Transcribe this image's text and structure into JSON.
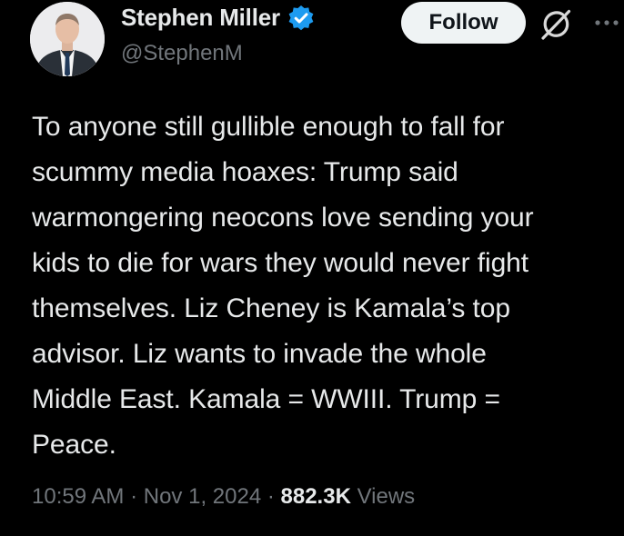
{
  "author": {
    "display_name": "Stephen Miller",
    "handle": "@StephenM",
    "verified": true,
    "verified_color": "#1d9bf0"
  },
  "icons": {
    "verified": "verified-badge-icon",
    "grok": "grok-icon",
    "more": "more-options-icon"
  },
  "actions": {
    "follow_label": "Follow"
  },
  "tweet": {
    "lines": [
      "To anyone still gullible enough to fall for",
      "scummy media hoaxes: Trump said",
      "warmongering neocons love sending your",
      "kids to die for wars they would never fight",
      "themselves. Liz Cheney is Kamala’s top",
      "advisor. Liz wants to invade the whole",
      "Middle East. Kamala = WWIII. Trump =",
      "Peace."
    ]
  },
  "meta": {
    "time": "10:59 AM",
    "separator": "·",
    "date": "Nov 1, 2024",
    "views_count": "882.3K",
    "views_label": "Views"
  },
  "colors": {
    "background": "#000000",
    "primary_text": "#e7e9ea",
    "secondary_text": "#71767b",
    "follow_bg": "#eff3f4"
  }
}
